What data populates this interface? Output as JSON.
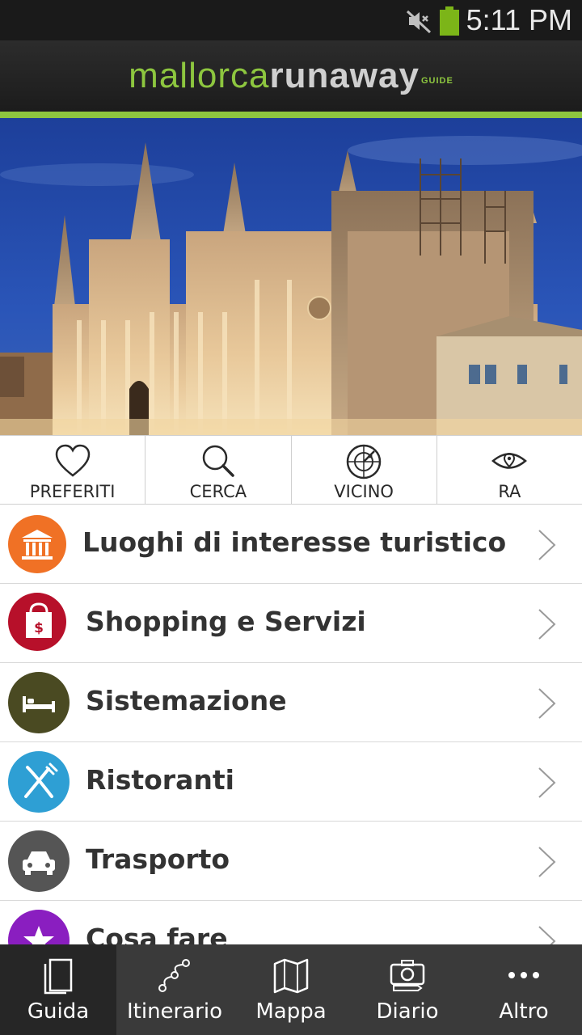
{
  "status_bar": {
    "time": "5:11 PM",
    "battery_color": "#7cb518"
  },
  "header": {
    "logo_part1": "mallorca",
    "logo_part2": "runaway",
    "logo_part3": "GUIDE",
    "accent_color": "#8dc63f"
  },
  "hero": {
    "subject": "Palma cathedral at dusk"
  },
  "quick_actions": [
    {
      "label": "PREFERITI",
      "icon": "heart-icon"
    },
    {
      "label": "CERCA",
      "icon": "search-icon"
    },
    {
      "label": "VICINO",
      "icon": "radar-icon"
    },
    {
      "label": "RA",
      "icon": "eye-location-icon"
    }
  ],
  "categories": [
    {
      "label": "Luoghi di interesse turistico",
      "icon": "museum-icon",
      "color": "#f07125"
    },
    {
      "label": "Shopping e Servizi",
      "icon": "shopping-bag-icon",
      "color": "#b7102a"
    },
    {
      "label": "Sistemazione",
      "icon": "bed-icon",
      "color": "#4a4a22"
    },
    {
      "label": "Ristoranti",
      "icon": "fork-knife-icon",
      "color": "#2e9fd4"
    },
    {
      "label": "Trasporto",
      "icon": "car-icon",
      "color": "#555555"
    },
    {
      "label": "Cosa fare",
      "icon": "star-icon",
      "color": "#8a1ec0"
    }
  ],
  "bottom_nav": [
    {
      "label": "Guida",
      "icon": "book-icon",
      "active": true
    },
    {
      "label": "Itinerario",
      "icon": "route-icon",
      "active": false
    },
    {
      "label": "Mappa",
      "icon": "map-icon",
      "active": false
    },
    {
      "label": "Diario",
      "icon": "camera-icon",
      "active": false
    },
    {
      "label": "Altro",
      "icon": "more-icon",
      "active": false
    }
  ]
}
